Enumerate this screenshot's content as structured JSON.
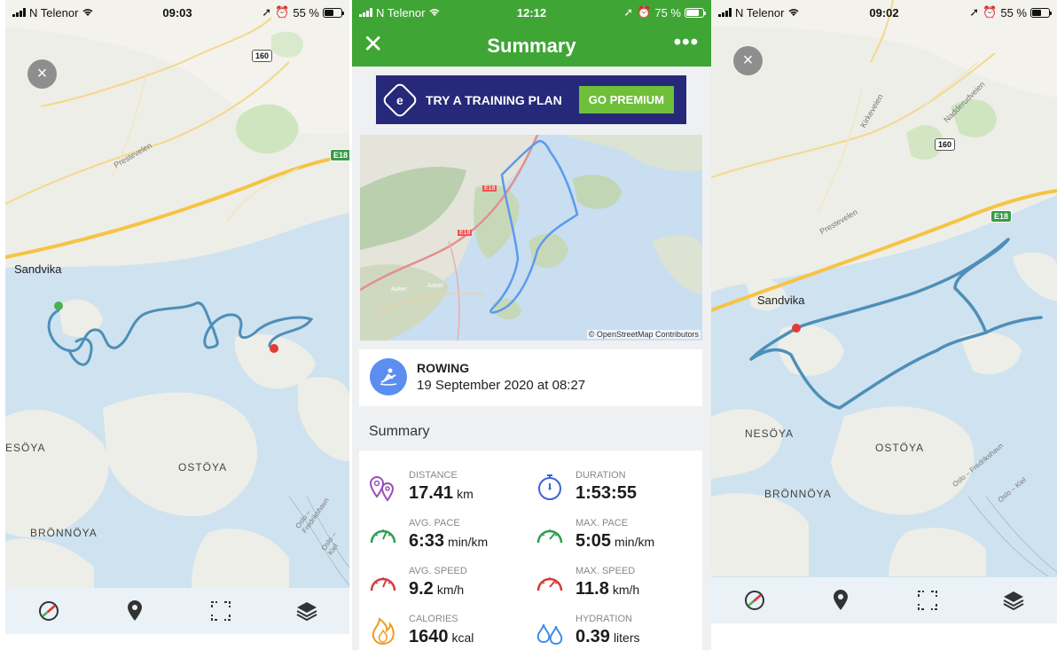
{
  "colors": {
    "app_green": "#3fa535",
    "promo_navy": "#26287a",
    "promo_button": "#6ebf3a",
    "track_left": "#4d8fb8",
    "track_middle": "#5b9aee",
    "start_marker": "#4caf50",
    "end_marker": "#e53935"
  },
  "left_screen": {
    "status": {
      "carrier": "N Telenor",
      "time": "09:03",
      "battery": "55 %"
    },
    "close": "×",
    "map_labels": {
      "town": "Sandvika",
      "island_1": "OSTÖYA",
      "island_2": "BRÖNNÖYA",
      "island_3": "ESÖYA",
      "road_sign_e": "E18",
      "road_sign_n": "160",
      "road_name": "Prestevelen",
      "ferry": "Oslo – Fredrikshavn",
      "ferry_2": "Oslo – Kiel"
    },
    "bottom_icons": [
      "route-icon",
      "pin-icon",
      "frame-icon",
      "layers-icon"
    ]
  },
  "middle_screen": {
    "status": {
      "carrier": "N Telenor",
      "time": "12:12",
      "battery": "75 %"
    },
    "header": {
      "close": "✕",
      "title": "Summary",
      "more": "•••"
    },
    "promo": {
      "text": "TRY A TRAINING PLAN",
      "button": "GO PREMIUM"
    },
    "map_attribution": "© OpenStreetMap Contributors",
    "map_labels": {
      "e18_a": "E18",
      "e18_b": "E18",
      "asker": "Asker",
      "asker_2": "Asker"
    },
    "activity": {
      "type": "ROWING",
      "date": "19 September 2020 at 08:27"
    },
    "section_title": "Summary",
    "stats": [
      {
        "label": "Distance",
        "value": "17.41",
        "unit": "km",
        "icon": "distance-icon"
      },
      {
        "label": "Duration",
        "value": "1:53:55",
        "unit": "",
        "icon": "stopwatch-icon"
      },
      {
        "label": "Avg. Pace",
        "value": "6:33",
        "unit": "min/km",
        "icon": "gauge-green-icon"
      },
      {
        "label": "Max. Pace",
        "value": "5:05",
        "unit": "min/km",
        "icon": "gauge-green-icon"
      },
      {
        "label": "Avg. Speed",
        "value": "9.2",
        "unit": "km/h",
        "icon": "gauge-red-icon"
      },
      {
        "label": "Max. Speed",
        "value": "11.8",
        "unit": "km/h",
        "icon": "gauge-red-icon"
      },
      {
        "label": "Calories",
        "value": "1640",
        "unit": "kcal",
        "icon": "flame-icon"
      },
      {
        "label": "Hydration",
        "value": "0.39",
        "unit": "liters",
        "icon": "drops-icon"
      }
    ]
  },
  "right_screen": {
    "status": {
      "carrier": "N Telenor",
      "time": "09:02",
      "battery": "55 %"
    },
    "close": "×",
    "map_labels": {
      "town": "Sandvika",
      "island_1": "OSTÖYA",
      "island_2": "NESÖYA",
      "island_3": "BRÖNNÖYA",
      "road_sign_e": "E18",
      "road_sign_n": "160",
      "road_name": "Prestevelen",
      "road_name_2": "Kirkeveien",
      "road_name_3": "Nadderudveien",
      "ferry": "Oslo – Fredrikshavn",
      "ferry_2": "Oslo – Kiel"
    },
    "bottom_icons": [
      "route-icon",
      "pin-icon",
      "frame-icon",
      "layers-icon"
    ]
  }
}
